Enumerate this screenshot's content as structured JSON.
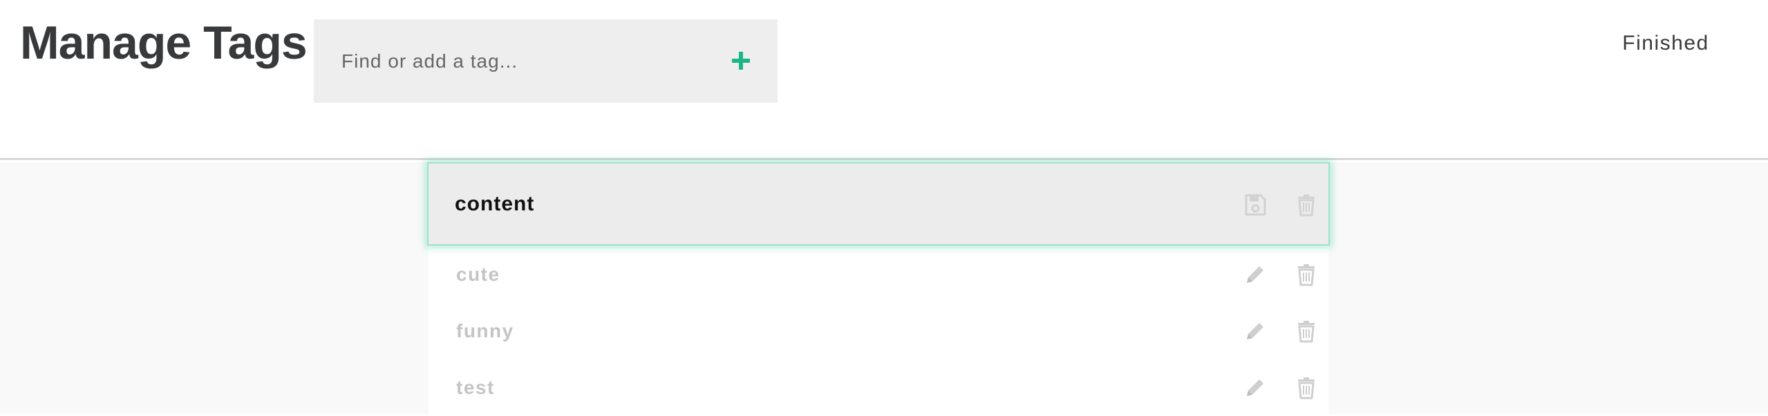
{
  "header": {
    "title": "Manage Tags",
    "search_placeholder": "Find or add a tag...",
    "add_icon": "plus-icon",
    "finished_label": "Finished"
  },
  "colors": {
    "accent": "#1bb58a",
    "edit_glow": "#9fe3cf",
    "muted_text": "#c4c4c4",
    "title_text": "#37393b"
  },
  "tags": {
    "editing": {
      "value": "content",
      "icons": [
        "save-icon",
        "trash-icon"
      ]
    },
    "items": [
      {
        "label": "cute",
        "icons": [
          "pencil-icon",
          "trash-icon"
        ]
      },
      {
        "label": "funny",
        "icons": [
          "pencil-icon",
          "trash-icon"
        ]
      },
      {
        "label": "test",
        "icons": [
          "pencil-icon",
          "trash-icon"
        ]
      }
    ]
  }
}
